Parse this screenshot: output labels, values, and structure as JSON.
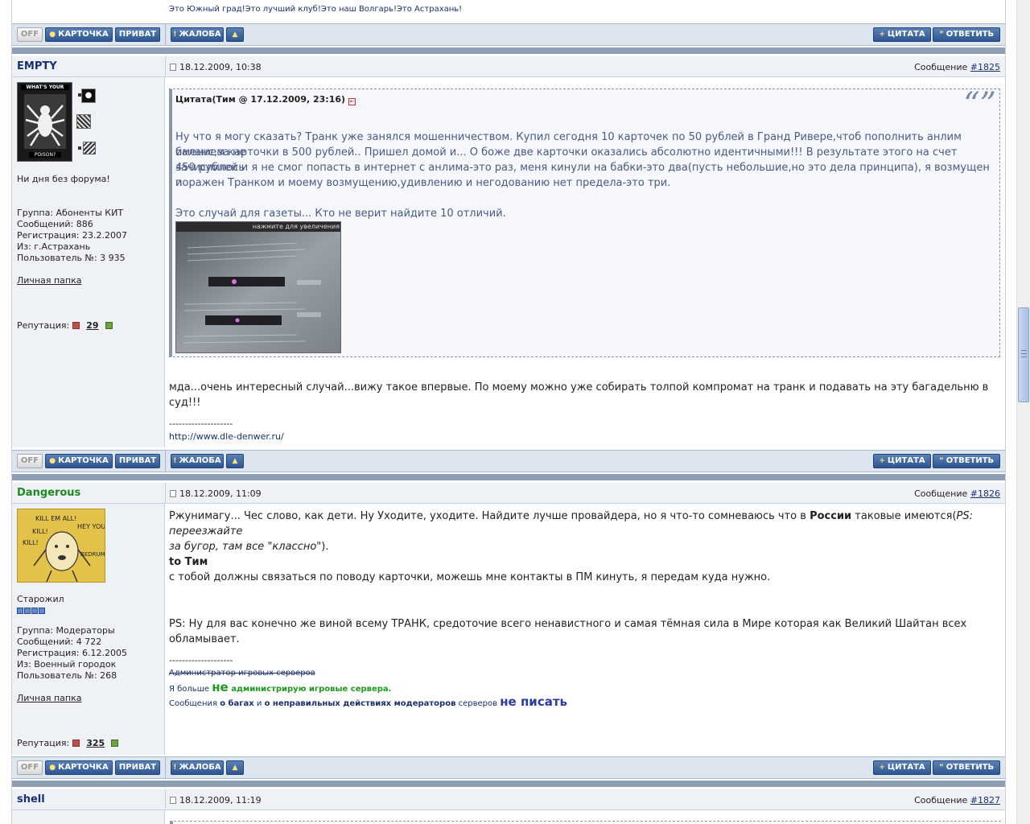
{
  "prev_post": {
    "signature_text": "Это Южный град!Это лучший клуб!Это наш Волгарь!Это Астрахань!"
  },
  "buttons": {
    "off": "OFF",
    "card": "КАРТОЧКА",
    "private": "ПРИВАТ",
    "complaint": "ЖАЛОБА",
    "quote": "ЦИТАТА",
    "reply": "ОТВЕТИТЬ",
    "msg_label": "Сообщение"
  },
  "posts": [
    {
      "user": "EMPTY",
      "date": "18.12.2009, 10:38",
      "msg_no": "#1825",
      "avatar_text_top": "WHAT'S YOUR",
      "avatar_text_bottom": "POISON?",
      "status": "Ни дня без форума!",
      "group": "Группа: Абоненты КИТ",
      "messages": "Сообщений: 886",
      "registered": "Регистрация: 23.2.2007",
      "from": "Из: г.Астрахань",
      "user_no": "Пользователь №: 3 935",
      "folder": "Личная папка",
      "rep_label": "Репутация:",
      "rep_value": "29",
      "quote_head": "Цитата(Тим @ 17.12.2009, 23:16)",
      "quote_lines": [
        "Ну что я могу сказать? Транк уже занялся мошенничеством. Купил сегодня 10 карточек по 50 рублей в Гранд Ривере,чтоб пополнить анлим баланс,за не",
        "имением карточки в 500 рублей.. Пришел домой и... О боже две карточки оказались абсолютно идентичными!!! В результате этого на счет зачислилось",
        "450 рублей и я не смог попасть в интернет с анлима-это раз, меня кинули на бабки-это два(пусть небольшие,но это дела принципа), я возмущен и",
        "поражен Транком и моему возмущению,удивлению и негодованию нет предела-это три.",
        "",
        "Это случай для газеты... Кто не верит найдите 10 отличий."
      ],
      "thumb_caption": "нажмите для увеличения",
      "body_text": "мда...очень интересный случай...вижу такое впервые. По моему можно уже собирать толпой компромат на транк и подавать на эту багадельню в суд!!!",
      "sig_dashes": "--------------------",
      "sig_link": "http://www.dle-denwer.ru/"
    },
    {
      "user": "Dangerous",
      "date": "18.12.2009, 11:09",
      "msg_no": "#1826",
      "avatar_words": [
        "KILL EM ALL!",
        "KILL!",
        "HEY YOU!",
        "KILL!",
        "REDRUM"
      ],
      "rank": "Старожил",
      "group": "Группа: Модераторы",
      "messages": "Сообщений: 4 722",
      "registered": "Регистрация: 6.12.2005",
      "from": "Из: Военный городок",
      "user_no": "Пользователь №: 268",
      "folder": "Личная папка",
      "rep_label": "Репутация:",
      "rep_value": "325",
      "p1_a": "Ржунимагу... Чес слово, как дети. Ну Уходите, уходите. Найдите лучше провайдера, но я что-то сомневаюсь что в ",
      "p1_bold": "России",
      "p1_b": " таковые имеются(",
      "p1_ital": "PS: переезжайте",
      "p1_line2": "за бугор, там все \"классно\"",
      "p1_end": ").",
      "to_label": "to Тим",
      "p2": "с тобой должны связаться по поводу карточки, можешь мне контакты в ПМ кинуть, я передам куда нужно.",
      "p3": "PS: Ну для вас конечно же виной всему ТРАНК, средоточие всего ненавистного и самая тёмная сила в Мире которая как Великий Шайтан всех обламывает.",
      "sig_dashes": "--------------------",
      "sig_strike": "Администратор игровых серверов",
      "sig2_a": "Я больше ",
      "sig2_big": "не",
      "sig2_b": " администрирую игровые сервера.",
      "sig3_a": "Сообщения ",
      "sig3_b": "о багах",
      "sig3_c": " и ",
      "sig3_d": "о неправильных действиях модераторов",
      "sig3_e": " серверов ",
      "sig3_big": "не писать"
    },
    {
      "user": "shell",
      "date": "18.12.2009, 11:19",
      "msg_no": "#1827"
    }
  ],
  "colors": {
    "accent": "#2e5590",
    "divider": "#8e9fb5",
    "profile_bg": "#eef2f7",
    "quote_text": "#4a5a86",
    "green_user": "#1f8a1f"
  }
}
